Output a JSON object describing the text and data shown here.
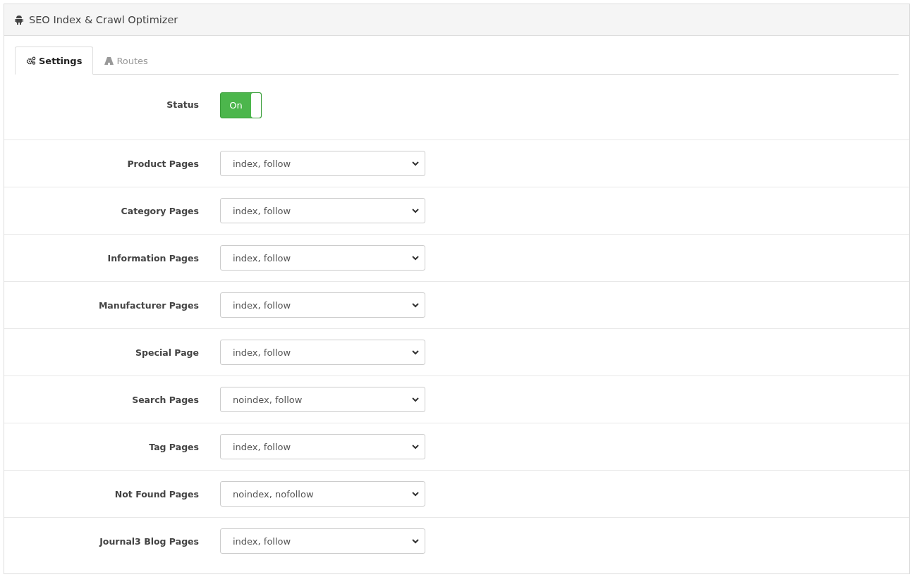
{
  "panel": {
    "title": "SEO Index & Crawl Optimizer"
  },
  "tabs": [
    {
      "label": "Settings",
      "selected": true
    },
    {
      "label": "Routes",
      "selected": false
    }
  ],
  "status": {
    "label": "Status",
    "on": true,
    "toggle_label": "On"
  },
  "settings": [
    {
      "label": "Product Pages",
      "value": "index, follow"
    },
    {
      "label": "Category Pages",
      "value": "index, follow"
    },
    {
      "label": "Information Pages",
      "value": "index, follow"
    },
    {
      "label": "Manufacturer Pages",
      "value": "index, follow"
    },
    {
      "label": "Special Page",
      "value": "index, follow"
    },
    {
      "label": "Search Pages",
      "value": "noindex, follow"
    },
    {
      "label": "Tag Pages",
      "value": "index, follow"
    },
    {
      "label": "Not Found Pages",
      "value": "noindex, nofollow"
    },
    {
      "label": "Journal3 Blog Pages",
      "value": "index, follow"
    }
  ]
}
